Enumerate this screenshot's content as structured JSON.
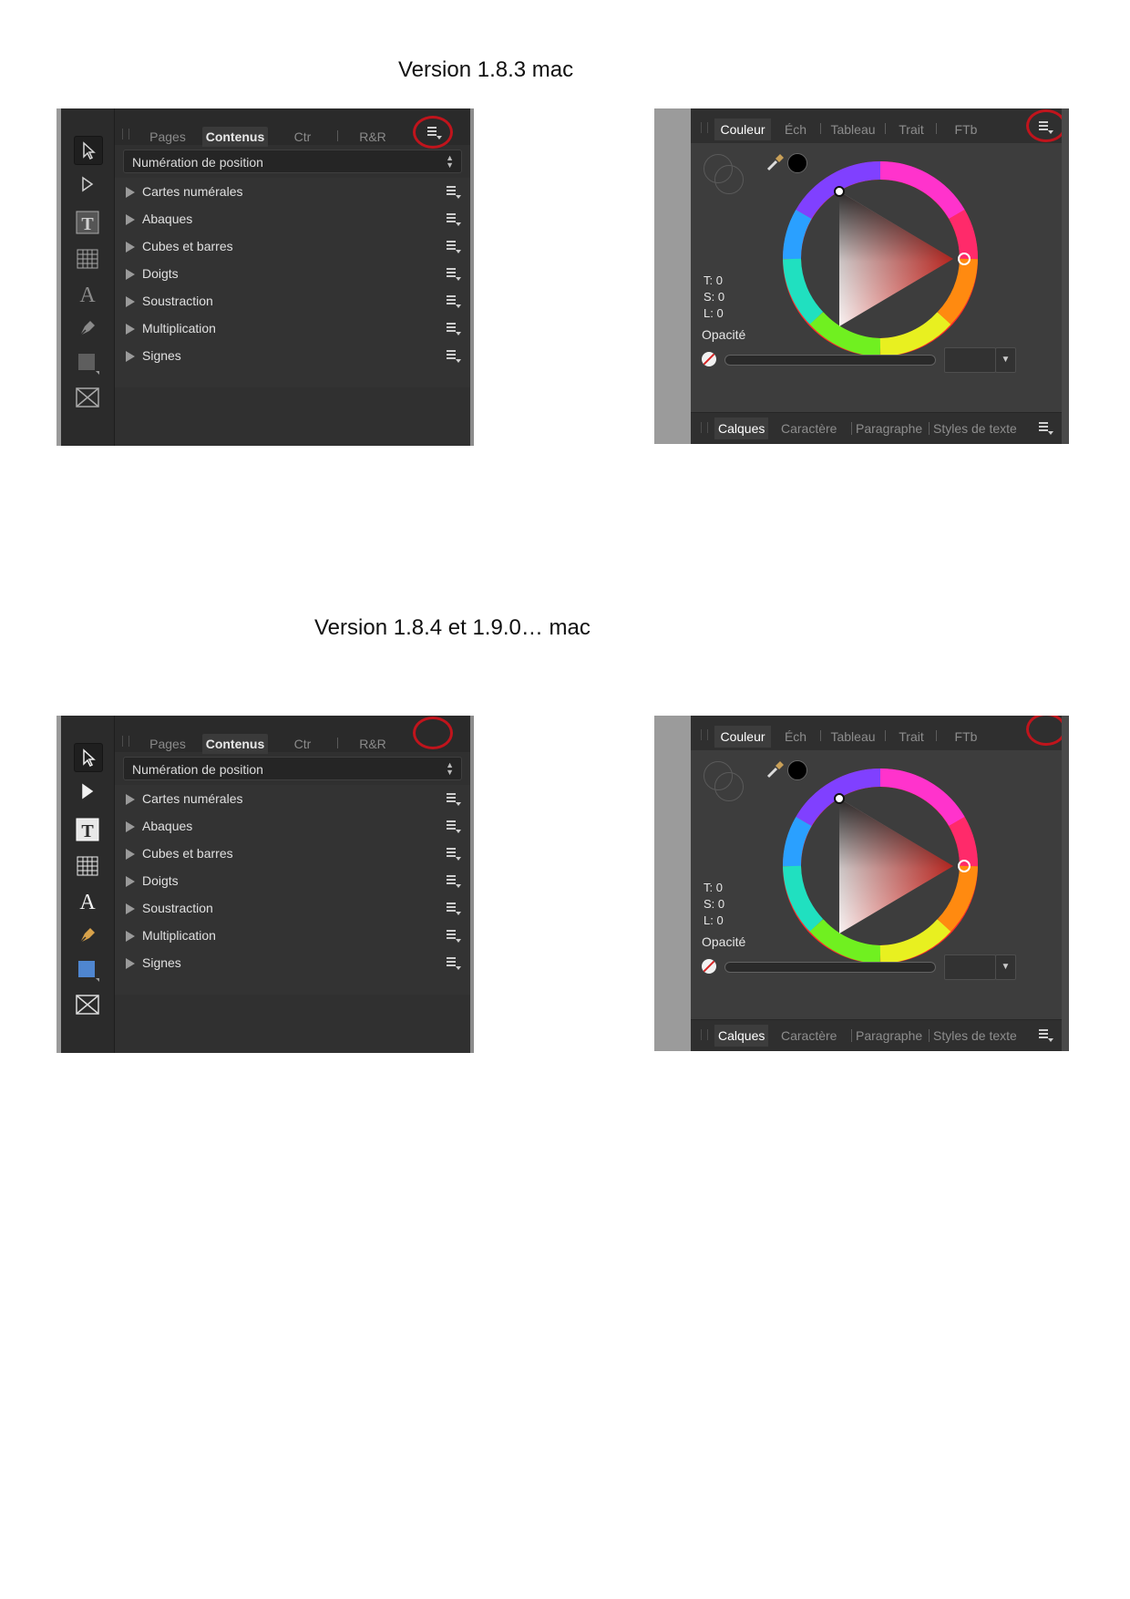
{
  "headings": {
    "v183": "Version 1.8.3 mac",
    "v184": "Version 1.8.4  et 1.9.0… mac"
  },
  "contents_panel": {
    "tabs": [
      "Pages",
      "Contenus",
      "Ctr",
      "R&R"
    ],
    "active_tab": "Contenus",
    "dropdown_value": "Numération de position",
    "items": [
      "Cartes numérales",
      "Abaques",
      "Cubes et barres",
      "Doigts",
      "Soustraction",
      "Multiplication",
      "Signes"
    ],
    "tools": [
      "pointer-icon",
      "node-icon",
      "text-frame-icon",
      "table-icon",
      "artistic-text-icon",
      "pen-icon",
      "rectangle-icon",
      "picture-frame-icon"
    ]
  },
  "color_panel": {
    "tabs": [
      "Couleur",
      "Éch",
      "Tableau",
      "Trait",
      "FTb"
    ],
    "active_tab": "Couleur",
    "t_label": "T: 0",
    "s_label": "S: 0",
    "l_label": "L: 0",
    "opacity_label": "Opacité",
    "bottom_tabs": [
      "Calques",
      "Caractère",
      "Paragraphe",
      "Styles de texte"
    ],
    "active_bottom_tab": "Calques"
  },
  "annotations": {
    "highlight_color": "#c0141c",
    "note": ""
  }
}
